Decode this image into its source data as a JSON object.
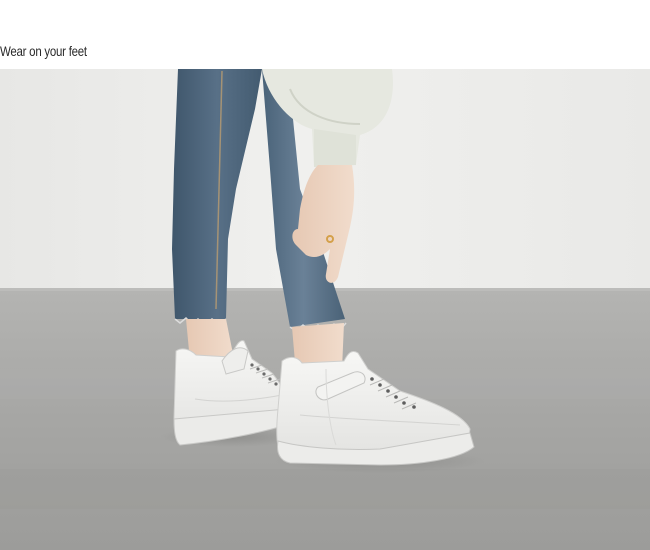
{
  "section": {
    "title": "Wear on your feet"
  },
  "photo": {
    "description_icon": "product-lifestyle-photo",
    "colors": {
      "wall": "#ececea",
      "floor": "#a9a9a7",
      "jeans": "#4b6479",
      "sneaker": "#f1f1ef",
      "sleeve": "#e4e6de",
      "skin": "#ecd3c0"
    }
  }
}
